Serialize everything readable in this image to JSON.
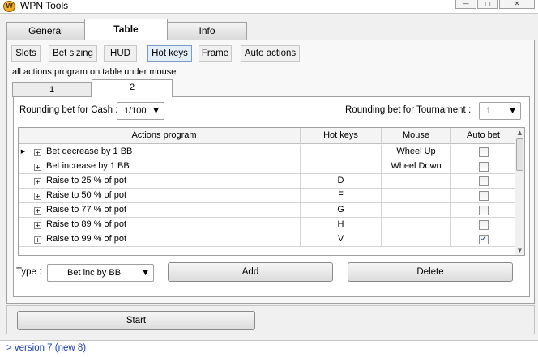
{
  "window": {
    "title": "WPN Tools",
    "icon_text": "W",
    "min": "—",
    "max": "▢",
    "close": "✕"
  },
  "main_tabs": [
    "General",
    "Table",
    "Info"
  ],
  "active_main_tab": "Table",
  "sub_tabs": [
    "Slots",
    "Bet sizing",
    "HUD",
    "Hot keys",
    "Frame",
    "Auto actions"
  ],
  "active_sub_tab": "Hot keys",
  "caption": "all actions program on table under mouse",
  "number_tabs": [
    "1",
    "2"
  ],
  "active_number_tab": "2",
  "rounding": {
    "cash_label": "Rounding bet for Cash :",
    "cash_value": "1/100",
    "tournament_label": "Rounding bet for Tournament :",
    "tournament_value": "1"
  },
  "grid": {
    "columns": [
      "Actions program",
      "Hot keys",
      "Mouse",
      "Auto bet"
    ],
    "rows": [
      {
        "action": "Bet decrease by 1 BB",
        "hotkey": "",
        "mouse": "Wheel Up",
        "auto_bet": false
      },
      {
        "action": "Bet increase by 1 BB",
        "hotkey": "",
        "mouse": "Wheel Down",
        "auto_bet": false
      },
      {
        "action": "Raise to 25 % of pot",
        "hotkey": "D",
        "mouse": "",
        "auto_bet": false
      },
      {
        "action": "Raise to 50 % of pot",
        "hotkey": "F",
        "mouse": "",
        "auto_bet": false
      },
      {
        "action": "Raise to 77 % of pot",
        "hotkey": "G",
        "mouse": "",
        "auto_bet": false
      },
      {
        "action": "Raise to 89 % of pot",
        "hotkey": "H",
        "mouse": "",
        "auto_bet": false
      },
      {
        "action": "Raise to 99 % of pot",
        "hotkey": "V",
        "mouse": "",
        "auto_bet": true
      }
    ],
    "expander_glyph": "+",
    "current_row_glyph": "▶"
  },
  "type_label": "Type :",
  "type_value": "Bet inc by BB",
  "add_label": "Add",
  "delete_label": "Delete",
  "start_label": "Start",
  "status": "> version 7 (new 8)",
  "caret": "▼",
  "check_glyph": "✓",
  "colors": {
    "status_text": "#1a3fb8",
    "accent": "#7a9cc4"
  }
}
